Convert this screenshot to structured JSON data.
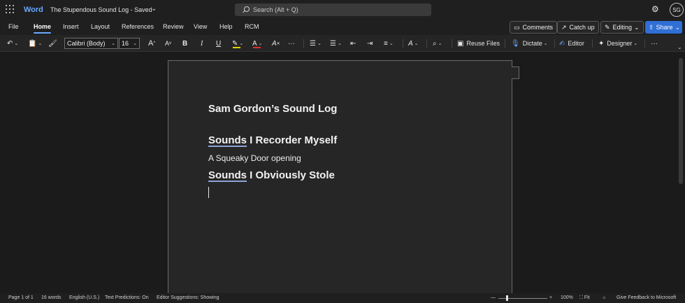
{
  "app": {
    "name": "Word",
    "doc_title": "The Stupendous Sound Log",
    "save_status": "Saved",
    "doc_title_full": "The Stupendous Sound Log  -  Saved",
    "search_placeholder": "Search (Alt + Q)",
    "user_initials": "SG"
  },
  "menu": {
    "tabs": [
      "File",
      "Home",
      "Insert",
      "Layout",
      "References",
      "Review",
      "View",
      "Help",
      "RCM"
    ],
    "active_tab": "Home",
    "comments_label": "Comments",
    "catchup_label": "Catch up",
    "editing_label": "Editing",
    "share_label": "Share"
  },
  "ribbon": {
    "font_name": "Calibri (Body)",
    "font_size": "16",
    "increase_font": "A",
    "decrease_font": "A",
    "bold": "B",
    "italic": "I",
    "underline": "U",
    "font_color_glyph": "A",
    "clear_format_glyph": "A",
    "more": "···",
    "reuse_files_label": "Reuse Files",
    "dictate_label": "Dictate",
    "editor_label": "Editor",
    "designer_label": "Designer",
    "highlight_color": "#e3d400",
    "font_color": "#e03131"
  },
  "document": {
    "title": "Sam Gordon’s Sound Log",
    "heading1_word": "Sounds",
    "heading1_rest": " I Recorder Myself",
    "body1": "A Squeaky Door opening",
    "heading2_word": "Sounds",
    "heading2_rest": " I Obviously Stole"
  },
  "status": {
    "page": "Page 1 of 1",
    "words": "16 words",
    "language": "English (U.S.)",
    "text_predictions": "Text Predictions: On",
    "editor_suggestions": "Editor Suggestions: Showing",
    "zoom": "100%",
    "fit": "Fit",
    "feedback": "Give Feedback to Microsoft",
    "zoom_minus": "—",
    "zoom_plus": "+"
  }
}
